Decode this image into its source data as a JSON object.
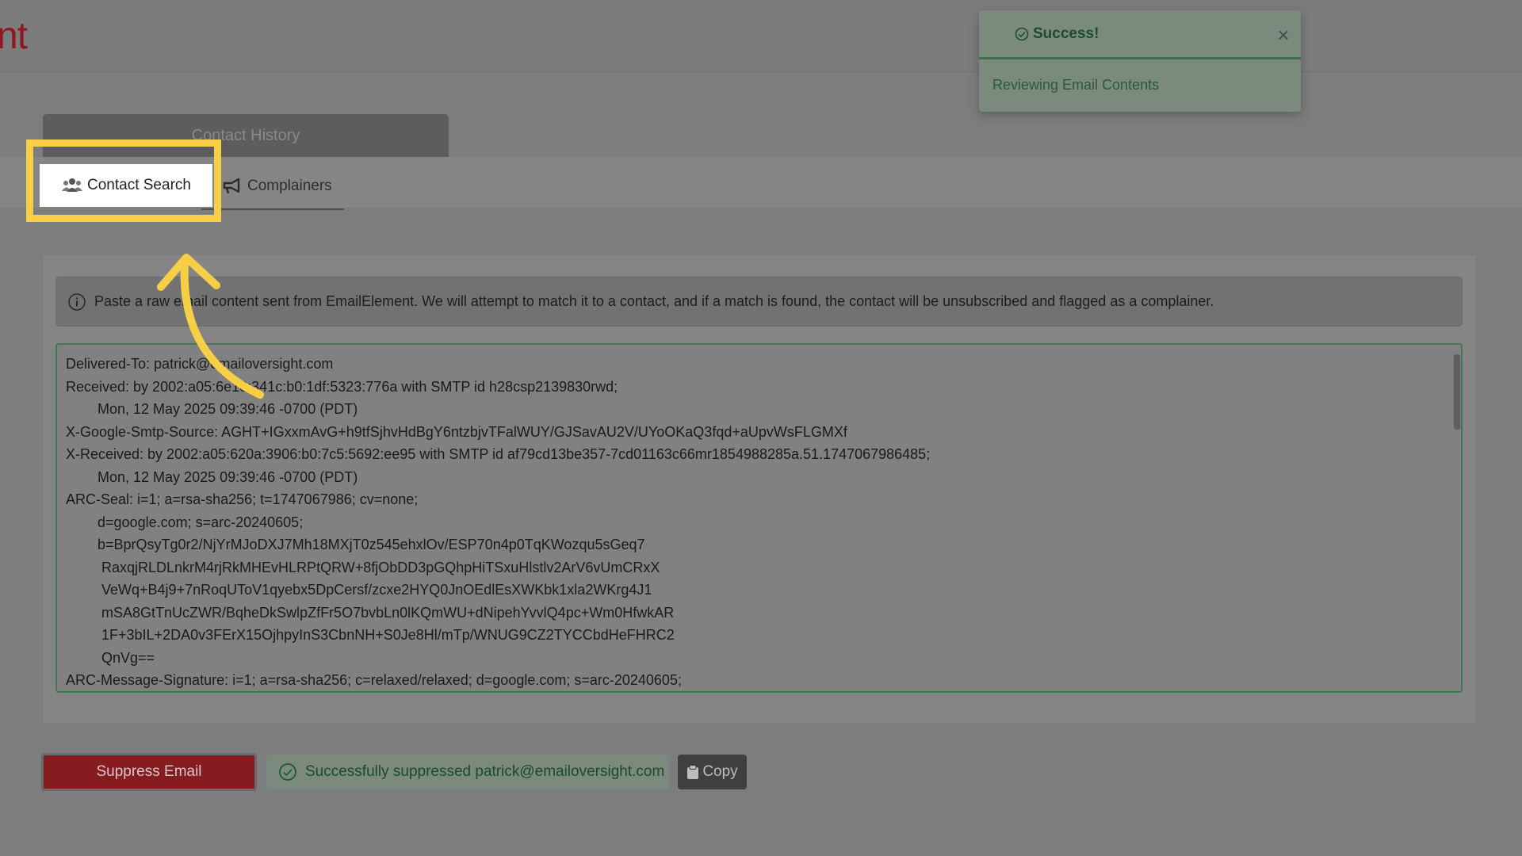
{
  "header": {
    "brand_fragment": "nt"
  },
  "tabs": {
    "contact_history": "Contact History",
    "contact_search": "Contact Search",
    "complainers": "Complainers"
  },
  "panel": {
    "info_text": "Paste a raw email content sent from EmailElement. We will attempt to match it to a contact, and if a match is found, the contact will be unsubscribed and flagged as a complainer.",
    "raw_email_lines": [
      "Delivered-To: patrick@emailoversight.com",
      "Received: by 2002:a05:6e18:341c:b0:1df:5323:776a with SMTP id h28csp2139830rwd;",
      "        Mon, 12 May 2025 09:39:46 -0700 (PDT)",
      "X-Google-Smtp-Source: AGHT+IGxxmAvG+h9tfSjhvHdBgY6ntzbjvTFalWUY/GJSavAU2V/UYoOKaQ3fqd+aUpvWsFLGMXf",
      "X-Received: by 2002:a05:620a:3906:b0:7c5:5692:ee95 with SMTP id af79cd13be357-7cd01163c66mr1854988285a.51.1747067986485;",
      "        Mon, 12 May 2025 09:39:46 -0700 (PDT)",
      "ARC-Seal: i=1; a=rsa-sha256; t=1747067986; cv=none;",
      "        d=google.com; s=arc-20240605;",
      "        b=BprQsyTg0r2/NjYrMJoDXJ7Mh18MXjT0z545ehxlOv/ESP70n4p0TqKWozqu5sGeq7",
      "         RaxqjRLDLnkrM4rjRkMHEvHLRPtQRW+8fjObDD3pGQhpHiTSxuHlstlv2ArV6vUmCRxX",
      "         VeWq+B4j9+7nRoqUToV1qyebx5DpCersf/zcxe2HYQ0JnOEdlEsXWKbk1xla2WKrg4J1",
      "         mSA8GtTnUcZWR/BqheDkSwlpZfFr5O7bvbLn0lKQmWU+dNipehYvvlQ4pc+Wm0HfwkAR",
      "         1F+3bIL+2DA0v3FErX15OjhpyInS3CbnNH+S0Je8Hl/mTp/WNUG9CZ2TYCCbdHeFHRC2",
      "         QnVg==",
      "ARC-Message-Signature: i=1; a=rsa-sha256; c=relaxed/relaxed; d=google.com; s=arc-20240605;"
    ]
  },
  "actions": {
    "suppress_label": "Suppress Email",
    "success_text": "Successfully suppressed patrick@emailoversight.com",
    "copy_label": "Copy"
  },
  "toast": {
    "title": "Success!",
    "message": "Reviewing Email Contents"
  },
  "colors": {
    "highlight": "#f7cf47",
    "brand_red": "#861b20",
    "success_green": "#3d7a52"
  },
  "icons": [
    "users-icon",
    "megaphone-icon",
    "info-icon",
    "check-circle-icon",
    "clipboard-icon",
    "close-icon"
  ]
}
